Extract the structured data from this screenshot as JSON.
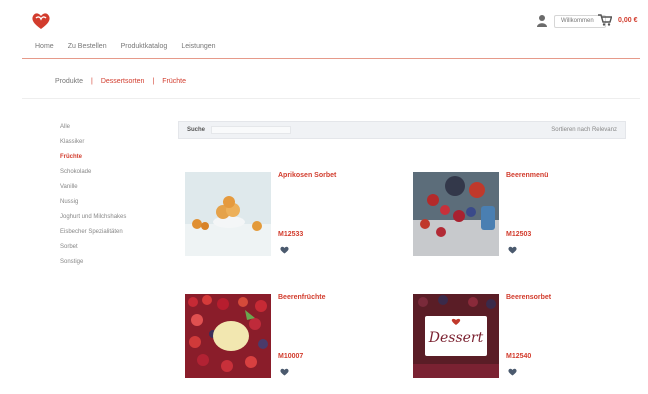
{
  "header": {
    "logo": "heart-brand-logo",
    "user_label": "Willkommen",
    "cart_amount": "0,00 €"
  },
  "nav": {
    "items": [
      "Home",
      "Zu Bestellen",
      "Produktkatalog",
      "Leistungen"
    ]
  },
  "breadcrumb": {
    "items": [
      "Produkte",
      "Dessertsorten",
      "Früchte"
    ]
  },
  "sidebar": {
    "items": [
      {
        "label": "Alle",
        "active": false
      },
      {
        "label": "Klassiker",
        "active": false
      },
      {
        "label": "Früchte",
        "active": true
      },
      {
        "label": "Schokolade",
        "active": false
      },
      {
        "label": "Vanille",
        "active": false
      },
      {
        "label": "Nussig",
        "active": false
      },
      {
        "label": "Joghurt und Milchshakes",
        "active": false
      },
      {
        "label": "Eisbecher Spezialitäten",
        "active": false
      },
      {
        "label": "Sorbet",
        "active": false
      },
      {
        "label": "Sonstige",
        "active": false
      }
    ]
  },
  "toolbar": {
    "label": "Suche",
    "search_placeholder": "",
    "sort_label": "Sortieren nach Relevanz"
  },
  "products": [
    {
      "name": "Aprikosen Sorbet",
      "sku": "M12533",
      "image": "apricot-sorbet-photo",
      "fav_icon": "heart-icon"
    },
    {
      "name": "Beerenmenü",
      "sku": "M12503",
      "image": "berry-mix-photo",
      "fav_icon": "heart-icon"
    },
    {
      "name": "Beerenfrüchte",
      "sku": "M10007",
      "image": "berry-fruits-photo",
      "fav_icon": "heart-icon"
    },
    {
      "name": "Beerensorbet",
      "sku": "M12540",
      "image": "dessert-berries-photo",
      "image_text": "Dessert",
      "fav_icon": "heart-icon"
    }
  ],
  "colors": {
    "accent": "#d23c2d",
    "toolbar_bg": "#f0f2f5"
  }
}
